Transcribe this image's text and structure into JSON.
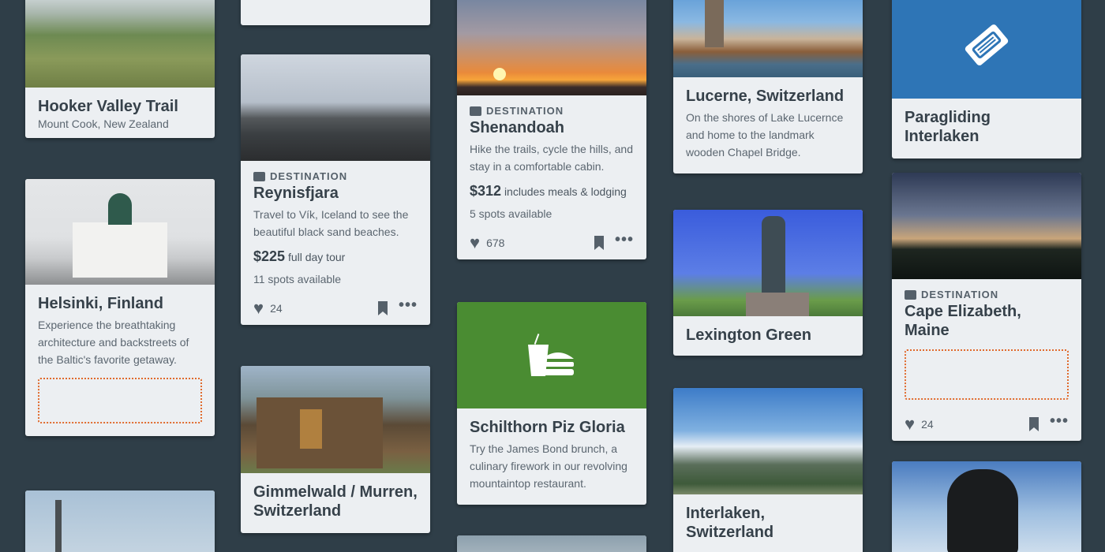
{
  "cards": {
    "hooker": {
      "title": "Hooker Valley Trail",
      "subtitle": "Mount Cook, New Zealand"
    },
    "helsinki": {
      "title": "Helsinki, Finland",
      "desc": "Experience the breathtaking architecture and backstreets of the Baltic's favorite getaway."
    },
    "reynisfjara": {
      "badge": "DESTINATION",
      "title": "Reynisfjara",
      "desc": "Travel to Vík, Iceland to see the beautiful black sand beaches.",
      "price": "$225",
      "price_note": "full day tour",
      "spots": "11 spots available",
      "likes": "24"
    },
    "gimmelwald": {
      "title": "Gimmelwald / Murren, Switzerland"
    },
    "shenandoah": {
      "badge": "DESTINATION",
      "title": "Shenandoah",
      "desc": "Hike the trails, cycle the hills, and stay in a comfortable cabin.",
      "price": "$312",
      "price_note": "includes meals & lodging",
      "spots": "5 spots available",
      "likes": "678"
    },
    "schilthorn": {
      "title": "Schilthorn Piz Gloria",
      "desc": "Try the James Bond brunch, a culinary firework in our revolving mountaintop restaurant."
    },
    "lucerne": {
      "title": "Lucerne, Switzerland",
      "desc": "On the shores of Lake Lucernce and home to the landmark wooden Chapel Bridge."
    },
    "lexington": {
      "title": "Lexington Green"
    },
    "interlaken": {
      "title": "Interlaken, Switzerland"
    },
    "paragliding": {
      "title": "Paragliding Interlaken"
    },
    "cape": {
      "badge": "DESTINATION",
      "title": "Cape Elizabeth, Maine",
      "likes": "24"
    }
  },
  "colors": {
    "background": "#2f3e48",
    "card": "#eceff2",
    "food_tile": "#4a8c32",
    "ticket_tile": "#2e75b6",
    "placeholder_border": "#e06a2c"
  },
  "icons": {
    "like": "heart-icon",
    "save": "bookmark-icon",
    "menu": "more-icon",
    "food": "food-icon",
    "ticket": "ticket-icon",
    "destination": "map-icon"
  }
}
